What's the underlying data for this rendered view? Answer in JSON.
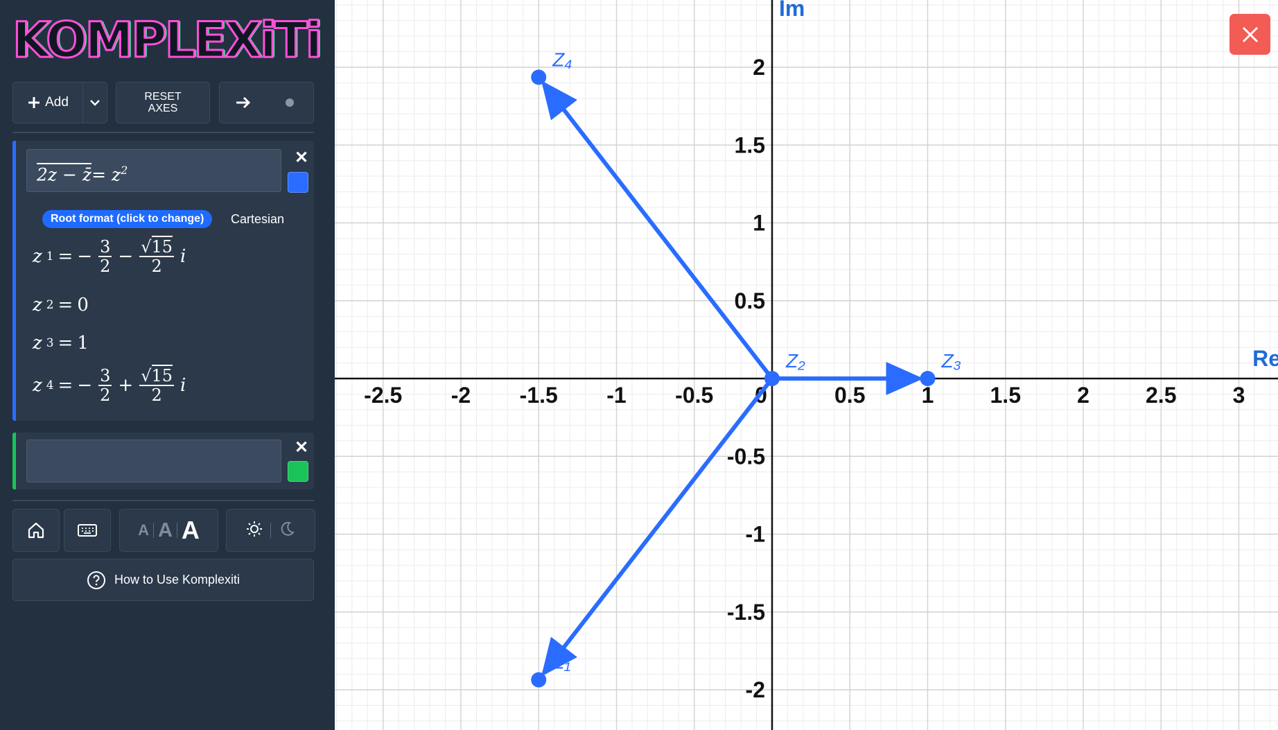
{
  "app": {
    "logo_text": "KOMPLEXiTi"
  },
  "toolbar": {
    "add_label": "Add",
    "reset_line1": "RESET",
    "reset_line2": "AXES"
  },
  "expressions": [
    {
      "input": "2z − z̄ = z²",
      "color": "#2a6cff",
      "root_format_label": "Root format (click to change)",
      "root_format_value": "Cartesian",
      "roots": [
        {
          "name": "z",
          "index": "1",
          "sign1": "−",
          "frac_num": "3",
          "frac_den": "2",
          "sign2": "−",
          "sqrt_num": "15",
          "sqrt_den": "2",
          "unit": "i"
        },
        {
          "name": "z",
          "index": "2",
          "value": "0"
        },
        {
          "name": "z",
          "index": "3",
          "value": "1"
        },
        {
          "name": "z",
          "index": "4",
          "sign1": "−",
          "frac_num": "3",
          "frac_den": "2",
          "sign2": "+",
          "sqrt_num": "15",
          "sqrt_den": "2",
          "unit": "i"
        }
      ]
    },
    {
      "input": "",
      "color": "#19c35a"
    }
  ],
  "help": {
    "label": "How to Use Komplexiti"
  },
  "font_size_labels": [
    "A",
    "A",
    "A"
  ],
  "chart_data": {
    "type": "scatter",
    "xlabel": "Re",
    "ylabel": "Im",
    "xlim": [
      -2.8,
      3.25
    ],
    "ylim": [
      -2.25,
      2.4
    ],
    "grid": true,
    "x_ticks": [
      -2.5,
      -2,
      -1.5,
      -1,
      -0.5,
      0,
      0.5,
      1,
      1.5,
      2,
      2.5,
      3
    ],
    "x_tick_labels": [
      "-2.5",
      "-2",
      "-1.5",
      "-1",
      "-0.5",
      "0",
      "0.5",
      "1",
      "1.5",
      "2",
      "2.5",
      "3"
    ],
    "y_ticks": [
      -2,
      -1.5,
      -1,
      -0.5,
      0.5,
      1,
      1.5,
      2
    ],
    "y_tick_labels": [
      "-2",
      "-1.5",
      "-1",
      "-0.5",
      "0.5",
      "1",
      "1.5",
      "2"
    ],
    "series": [
      {
        "color": "#2a6cff",
        "points": [
          {
            "label": "Z₁",
            "x": -1.5,
            "y": -1.936
          },
          {
            "label": "Z₂",
            "x": 0,
            "y": 0
          },
          {
            "label": "Z₃",
            "x": 1,
            "y": 0
          },
          {
            "label": "Z₄",
            "x": -1.5,
            "y": 1.936
          }
        ],
        "vectors_from_origin": true
      }
    ]
  }
}
